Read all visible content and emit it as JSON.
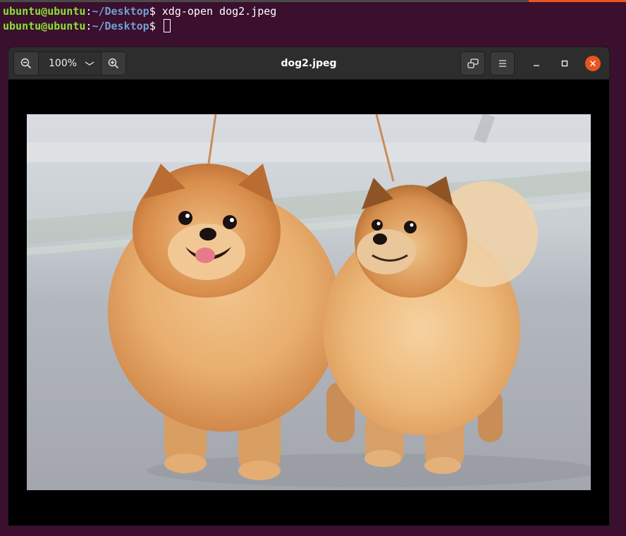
{
  "terminal": {
    "lines": [
      {
        "user": "ubuntu@ubuntu",
        "sep": ":",
        "path": "~/Desktop",
        "prompt": "$ ",
        "command": "xdg-open dog2.jpeg"
      },
      {
        "user": "ubuntu@ubuntu",
        "sep": ":",
        "path": "~/Desktop",
        "prompt": "$ ",
        "command": ""
      }
    ]
  },
  "viewer": {
    "title": "dog2.jpeg",
    "zoom": {
      "value": "100%",
      "out_icon": "zoom-out-icon",
      "in_icon": "zoom-in-icon",
      "menu_icon": "chevron-down-icon"
    },
    "buttons": {
      "rotate_icon": "rotate-icon",
      "menu_icon": "hamburger-menu-icon",
      "minimize_icon": "minimize-icon",
      "maximize_icon": "maximize-icon",
      "close_icon": "close-icon"
    },
    "image": {
      "subject": "photo-of-two-pomeranian-dogs"
    }
  },
  "colors": {
    "terminal_bg": "#3b0f2e",
    "prompt_user": "#8ae234",
    "prompt_path": "#729fcf",
    "headerbar": "#2d2d2d",
    "close_button": "#e95420"
  }
}
